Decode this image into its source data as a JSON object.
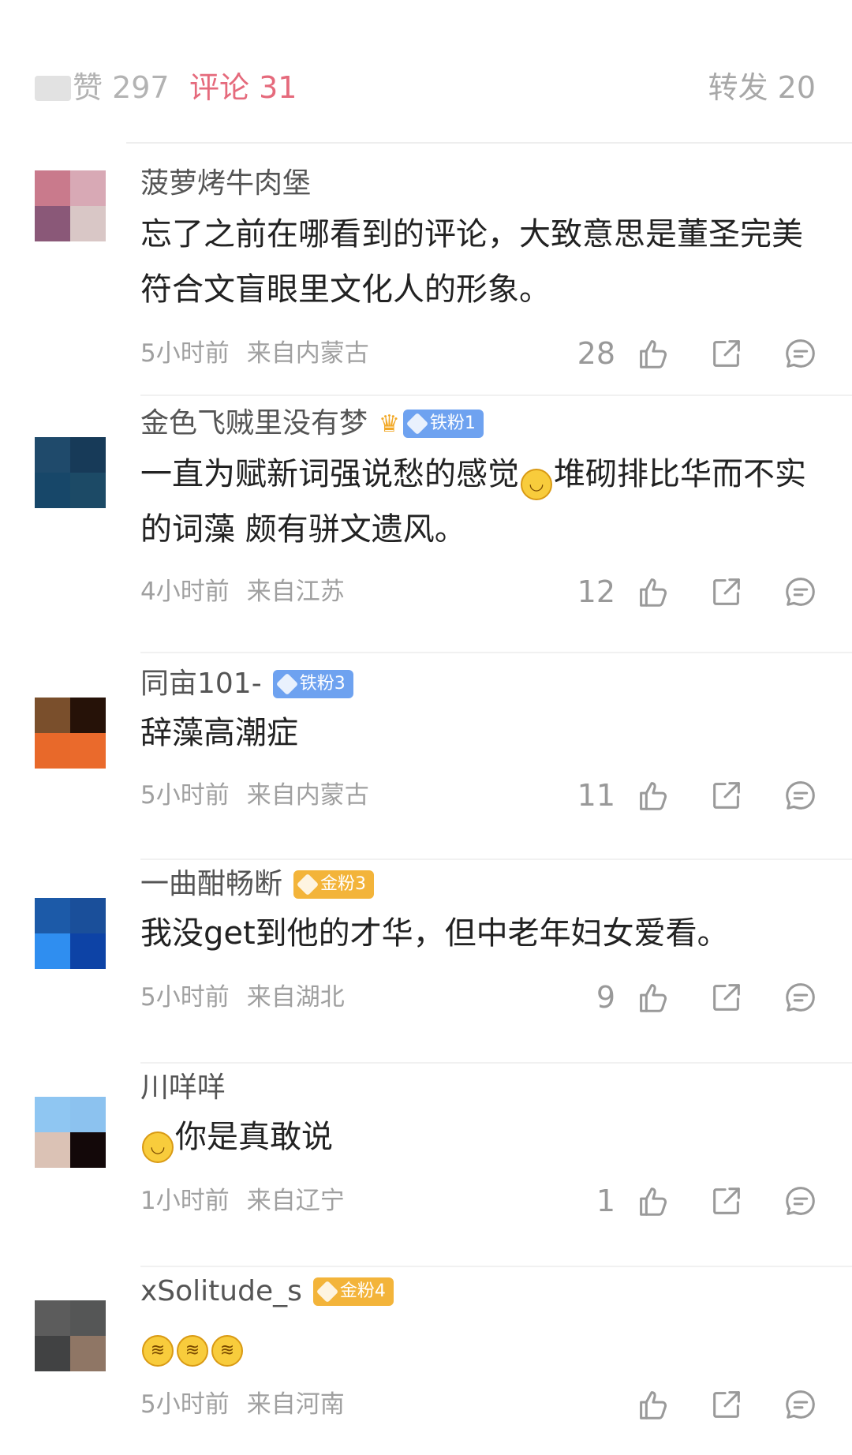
{
  "tabs": {
    "likes": "赞 297",
    "comments": "评论 31",
    "reposts": "转发 20"
  },
  "accent_color": "#e56a7c",
  "comments": [
    {
      "username": "菠萝烤牛肉堡",
      "badge": "",
      "text": "忘了之前在哪看到的评论，大致意思是董圣完美符合文盲眼里文化人的形象。",
      "time": "5小时前",
      "location": "来自内蒙古",
      "likes": "28"
    },
    {
      "username": "金色飞贼里没有梦",
      "badge": "铁粉1",
      "text_before": "一直为赋新词强说愁的感觉",
      "text_after": "堆砌排比华而不实的词藻 颇有骈文遗风。",
      "time": "4小时前",
      "location": "来自江苏",
      "likes": "12"
    },
    {
      "username": "同亩101-",
      "badge": "铁粉3",
      "text": "辞藻高潮症",
      "time": "5小时前",
      "location": "来自内蒙古",
      "likes": "11"
    },
    {
      "username": "一曲酣畅断",
      "badge": "金粉3",
      "text": "我没get到他的才华，但中老年妇女爱看。",
      "time": "5小时前",
      "location": "来自湖北",
      "likes": "9"
    },
    {
      "username": "川咩咩",
      "badge": "",
      "text": "你是真敢说",
      "time": "1小时前",
      "location": "来自辽宁",
      "likes": "1"
    },
    {
      "username": "xSolitude_s",
      "badge": "金粉4",
      "text": "",
      "time": "5小时前",
      "location": "来自河南",
      "likes": ""
    }
  ]
}
